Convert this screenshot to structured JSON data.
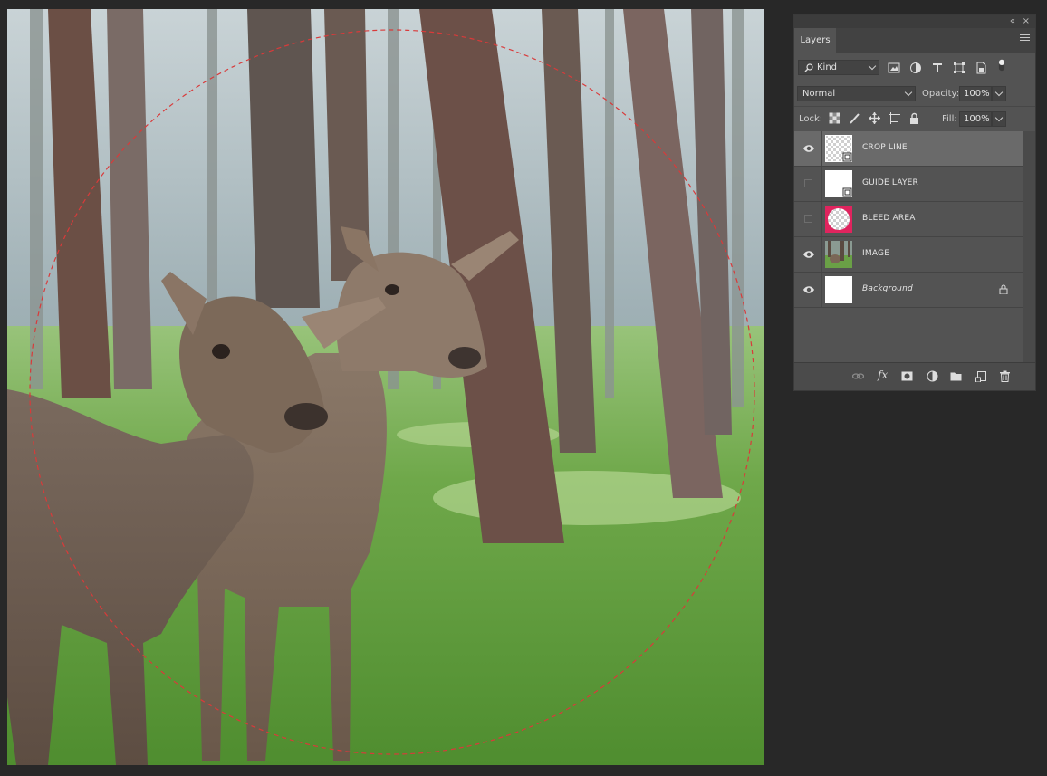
{
  "panel": {
    "collapse_glyph": "«",
    "close_glyph": "×",
    "tab_label": "Layers",
    "filter": {
      "kind_label": "Kind"
    },
    "blend_mode": "Normal",
    "opacity_label": "Opacity:",
    "opacity_value": "100%",
    "lock_label": "Lock:",
    "fill_label": "Fill:",
    "fill_value": "100%",
    "layers": [
      {
        "name": "CROP LINE",
        "visible": true,
        "selected": true
      },
      {
        "name": "GUIDE LAYER",
        "visible": false,
        "selected": false
      },
      {
        "name": "BLEED AREA",
        "visible": false,
        "selected": false
      },
      {
        "name": "IMAGE",
        "visible": true,
        "selected": false
      },
      {
        "name": "Background",
        "visible": true,
        "selected": false,
        "locked": true
      }
    ]
  },
  "canvas": {
    "overlay": "dashed-circle",
    "overlay_color": "#d93a3a",
    "subject": "two-fallow-deer-in-pine-forest"
  },
  "colors": {
    "app_background": "#282828",
    "panel_background": "#535353",
    "selected_row": "#6a6a6a",
    "bleed_thumb": "#e0245e"
  },
  "icons": {
    "filter": [
      "image-filter-icon",
      "adjustment-filter-icon",
      "type-filter-icon",
      "shape-filter-icon",
      "smart-object-filter-icon",
      "filter-toggle-icon"
    ],
    "lock": [
      "lock-transparent-pixels-icon",
      "lock-image-pixels-icon",
      "lock-position-icon",
      "lock-artboard-icon",
      "lock-all-icon"
    ],
    "bottom": [
      "link-layers-icon",
      "fx-icon",
      "add-mask-icon",
      "adjustment-layer-icon",
      "new-group-icon",
      "new-layer-icon",
      "delete-layer-icon"
    ]
  }
}
